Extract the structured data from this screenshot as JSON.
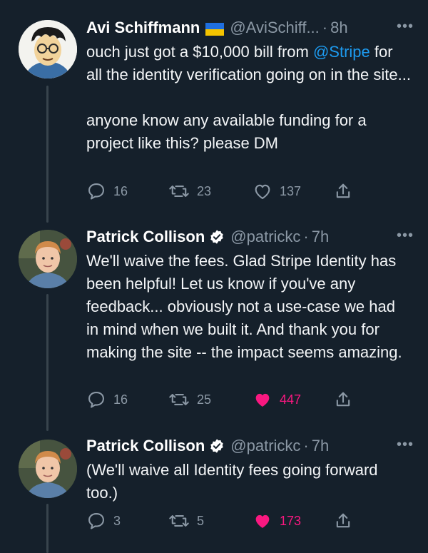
{
  "tweets": [
    {
      "name": "Avi Schiffmann",
      "handle": "@AviSchiff...",
      "time": "8h",
      "text_before": "ouch just got a $10,000 bill from ",
      "mention": "@Stripe",
      "text_after": " for all the identity verification going on in the site...\n\nanyone know any available funding for a project like this? please DM",
      "replies": "16",
      "retweets": "23",
      "likes": "137"
    },
    {
      "name": "Patrick Collison",
      "handle": "@patrickc",
      "time": "7h",
      "text": "We'll waive the fees. Glad Stripe Identity has been helpful! Let us know if you've any feedback... obviously not a use-case we had in mind when we built it. And thank you for making the site -- the impact seems amazing.",
      "replies": "16",
      "retweets": "25",
      "likes": "447"
    },
    {
      "name": "Patrick Collison",
      "handle": "@patrickc",
      "time": "7h",
      "text": "(We'll waive all Identity fees going forward too.)",
      "replies": "3",
      "retweets": "5",
      "likes": "173"
    }
  ],
  "separator": "·",
  "more_glyph": "•••",
  "colors": {
    "background": "#15202b",
    "link": "#1d9bf0",
    "muted": "#8b98a5",
    "like_active": "#f91880",
    "verified": "#ffffff"
  },
  "icons": [
    "reply-icon",
    "retweet-icon",
    "like-icon",
    "share-icon",
    "verified-icon",
    "ukraine-flag-icon",
    "more-icon"
  ]
}
